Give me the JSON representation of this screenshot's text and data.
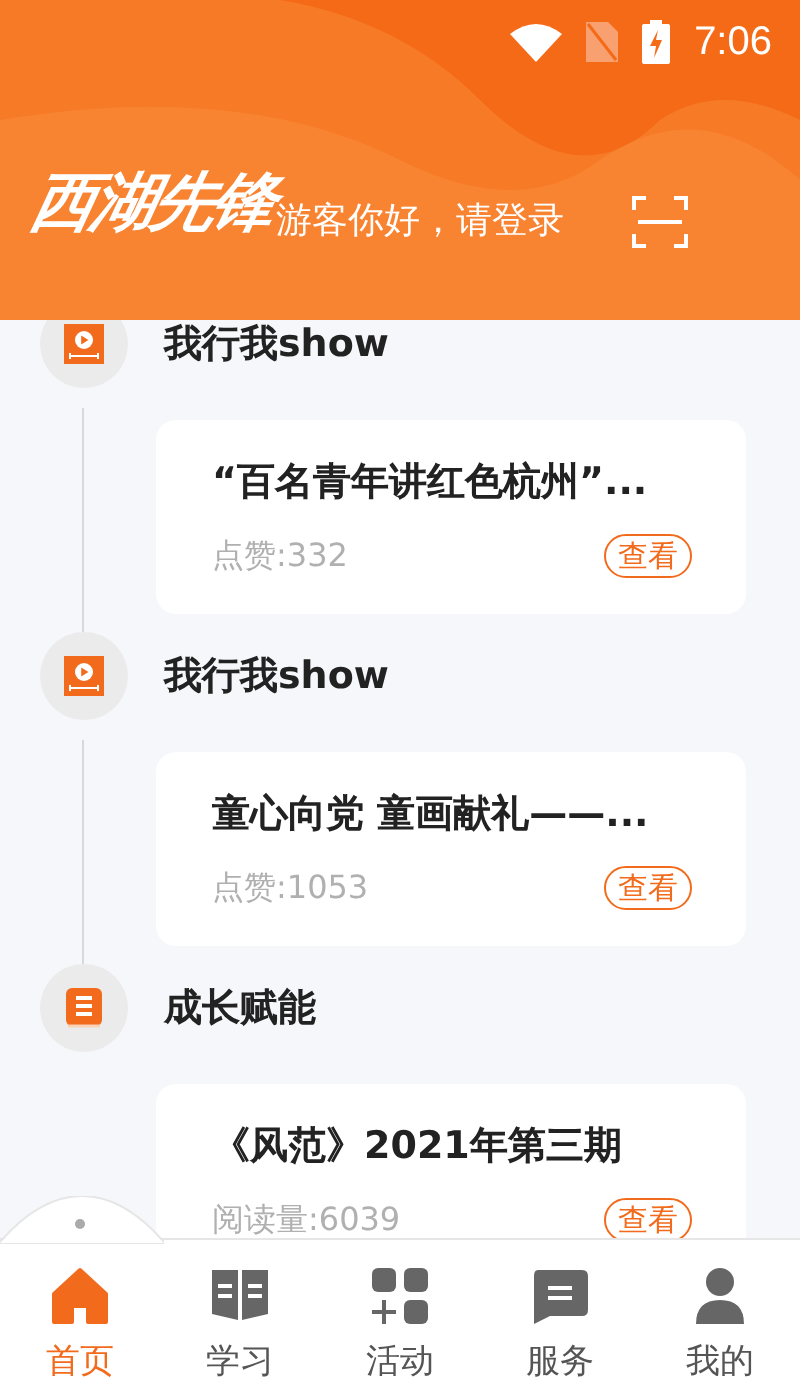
{
  "status_bar": {
    "time": "7:06"
  },
  "header": {
    "logo": "西湖先锋",
    "greeting": "游客你好，请登录"
  },
  "sections": [
    {
      "kind": "video",
      "title": "我行我show",
      "card": {
        "title": "“百名青年讲红色杭州”...",
        "stat": "点赞:332",
        "action": "查看"
      }
    },
    {
      "kind": "video",
      "title": "我行我show",
      "card": {
        "title": "童心向党 童画献礼——...",
        "stat": "点赞:1053",
        "action": "查看"
      }
    },
    {
      "kind": "book",
      "title": "成长赋能",
      "card": {
        "title": "《风范》2021年第三期",
        "stat": "阅读量:6039",
        "action": "查看"
      }
    }
  ],
  "tabs": [
    {
      "kind": "home",
      "label": "首页",
      "selected": true
    },
    {
      "kind": "study",
      "label": "学习",
      "selected": false
    },
    {
      "kind": "activity",
      "label": "活动",
      "selected": false
    },
    {
      "kind": "service",
      "label": "服务",
      "selected": false
    },
    {
      "kind": "profile",
      "label": "我的",
      "selected": false
    }
  ]
}
